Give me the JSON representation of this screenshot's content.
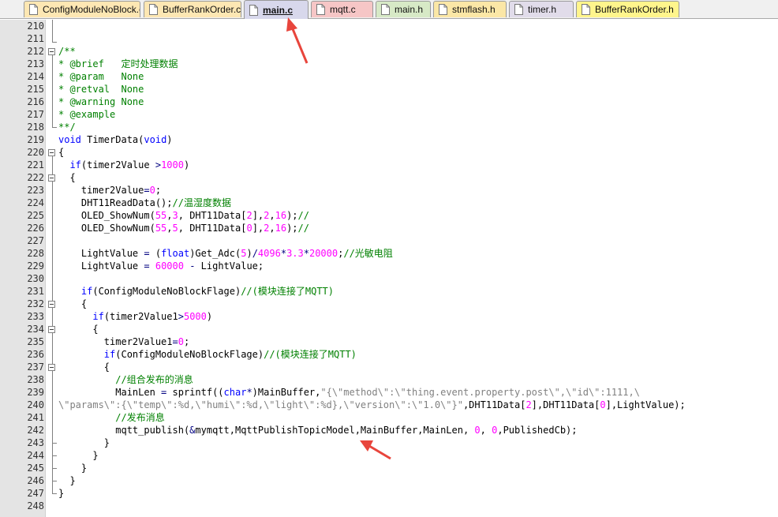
{
  "tabs": [
    {
      "label": "ConfigModuleNoBlock.c",
      "color": "#fde7b3",
      "active": false
    },
    {
      "label": "BufferRankOrder.c",
      "color": "#fde7b3",
      "active": false
    },
    {
      "label": "main.c",
      "color": "#d8d8ec",
      "active": true
    },
    {
      "label": "mqtt.c",
      "color": "#f6c6c6",
      "active": false
    },
    {
      "label": "main.h",
      "color": "#d7e9c6",
      "active": false
    },
    {
      "label": "stmflash.h",
      "color": "#fbe7a6",
      "active": false
    },
    {
      "label": "timer.h",
      "color": "#e1dcea",
      "active": false
    },
    {
      "label": "BufferRankOrder.h",
      "color": "#fff58c",
      "active": false
    }
  ],
  "editor": {
    "lines": [
      {
        "num": "210",
        "tokens": []
      },
      {
        "num": "211",
        "tokens": []
      },
      {
        "num": "212",
        "tokens": [
          [
            "c",
            "/**"
          ]
        ]
      },
      {
        "num": "213",
        "tokens": [
          [
            "c",
            "* @brief   定时处理数据"
          ]
        ]
      },
      {
        "num": "214",
        "tokens": [
          [
            "c",
            "* @param   None"
          ]
        ]
      },
      {
        "num": "215",
        "tokens": [
          [
            "c",
            "* @retval  None"
          ]
        ]
      },
      {
        "num": "216",
        "tokens": [
          [
            "c",
            "* @warning None"
          ]
        ]
      },
      {
        "num": "217",
        "tokens": [
          [
            "c",
            "* @example"
          ]
        ]
      },
      {
        "num": "218",
        "tokens": [
          [
            "c",
            "**/"
          ]
        ]
      },
      {
        "num": "219",
        "tokens": [
          [
            "k",
            "void"
          ],
          [
            "p",
            " TimerData("
          ],
          [
            "k",
            "void"
          ],
          [
            "p",
            ")"
          ]
        ]
      },
      {
        "num": "220",
        "tokens": [
          [
            "p",
            "{"
          ]
        ]
      },
      {
        "num": "221",
        "tokens": [
          [
            "p",
            "  "
          ],
          [
            "k",
            "if"
          ],
          [
            "p",
            "(timer2Value "
          ],
          [
            "o",
            ">"
          ],
          [
            "n",
            "1000"
          ],
          [
            "p",
            ")"
          ]
        ]
      },
      {
        "num": "222",
        "tokens": [
          [
            "p",
            "  {"
          ]
        ]
      },
      {
        "num": "223",
        "tokens": [
          [
            "p",
            "    timer2Value"
          ],
          [
            "o",
            "="
          ],
          [
            "n",
            "0"
          ],
          [
            "p",
            ";"
          ]
        ]
      },
      {
        "num": "224",
        "tokens": [
          [
            "p",
            "    DHT11ReadData();"
          ],
          [
            "c",
            "//温湿度数据"
          ]
        ]
      },
      {
        "num": "225",
        "tokens": [
          [
            "p",
            "    OLED_ShowNum("
          ],
          [
            "n",
            "55"
          ],
          [
            "p",
            ","
          ],
          [
            "n",
            "3"
          ],
          [
            "p",
            ", DHT11Data["
          ],
          [
            "n",
            "2"
          ],
          [
            "p",
            "],"
          ],
          [
            "n",
            "2"
          ],
          [
            "p",
            ","
          ],
          [
            "n",
            "16"
          ],
          [
            "p",
            ");"
          ],
          [
            "c",
            "//"
          ]
        ]
      },
      {
        "num": "226",
        "tokens": [
          [
            "p",
            "    OLED_ShowNum("
          ],
          [
            "n",
            "55"
          ],
          [
            "p",
            ","
          ],
          [
            "n",
            "5"
          ],
          [
            "p",
            ", DHT11Data["
          ],
          [
            "n",
            "0"
          ],
          [
            "p",
            "],"
          ],
          [
            "n",
            "2"
          ],
          [
            "p",
            ","
          ],
          [
            "n",
            "16"
          ],
          [
            "p",
            ");"
          ],
          [
            "c",
            "//"
          ]
        ]
      },
      {
        "num": "227",
        "tokens": []
      },
      {
        "num": "228",
        "tokens": [
          [
            "p",
            "    LightValue "
          ],
          [
            "o",
            "="
          ],
          [
            "p",
            " ("
          ],
          [
            "k",
            "float"
          ],
          [
            "p",
            ")Get_Adc("
          ],
          [
            "n",
            "5"
          ],
          [
            "p",
            ")"
          ],
          [
            "o",
            "/"
          ],
          [
            "n",
            "4096"
          ],
          [
            "o",
            "*"
          ],
          [
            "n",
            "3.3"
          ],
          [
            "o",
            "*"
          ],
          [
            "n",
            "20000"
          ],
          [
            "p",
            ";"
          ],
          [
            "c",
            "//光敏电阻"
          ]
        ]
      },
      {
        "num": "229",
        "tokens": [
          [
            "p",
            "    LightValue "
          ],
          [
            "o",
            "="
          ],
          [
            "p",
            " "
          ],
          [
            "n",
            "60000"
          ],
          [
            "p",
            " "
          ],
          [
            "o",
            "-"
          ],
          [
            "p",
            " LightValue;"
          ]
        ]
      },
      {
        "num": "230",
        "tokens": []
      },
      {
        "num": "231",
        "tokens": [
          [
            "p",
            "    "
          ],
          [
            "k",
            "if"
          ],
          [
            "p",
            "(ConfigModuleNoBlockFlage)"
          ],
          [
            "c",
            "//(模块连接了MQTT)"
          ]
        ]
      },
      {
        "num": "232",
        "tokens": [
          [
            "p",
            "    {"
          ]
        ]
      },
      {
        "num": "233",
        "tokens": [
          [
            "p",
            "      "
          ],
          [
            "k",
            "if"
          ],
          [
            "p",
            "(timer2Value1"
          ],
          [
            "o",
            ">"
          ],
          [
            "n",
            "5000"
          ],
          [
            "p",
            ")"
          ]
        ]
      },
      {
        "num": "234",
        "tokens": [
          [
            "p",
            "      {"
          ]
        ]
      },
      {
        "num": "235",
        "tokens": [
          [
            "p",
            "        timer2Value1"
          ],
          [
            "o",
            "="
          ],
          [
            "n",
            "0"
          ],
          [
            "p",
            ";"
          ]
        ]
      },
      {
        "num": "236",
        "tokens": [
          [
            "p",
            "        "
          ],
          [
            "k",
            "if"
          ],
          [
            "p",
            "(ConfigModuleNoBlockFlage)"
          ],
          [
            "c",
            "//(模块连接了MQTT)"
          ]
        ]
      },
      {
        "num": "237",
        "tokens": [
          [
            "p",
            "        {"
          ]
        ]
      },
      {
        "num": "238",
        "tokens": [
          [
            "p",
            "          "
          ],
          [
            "c",
            "//组合发布的消息"
          ]
        ]
      },
      {
        "num": "239",
        "tokens": [
          [
            "p",
            "          MainLen "
          ],
          [
            "o",
            "="
          ],
          [
            "p",
            " sprintf(("
          ],
          [
            "k",
            "char"
          ],
          [
            "o",
            "*"
          ],
          [
            "p",
            ")MainBuffer,"
          ],
          [
            "s",
            "\"{\\\"method\\\":\\\"thing.event.property.post\\\",\\\"id\\\":1111,\\"
          ]
        ]
      },
      {
        "num": "240",
        "tokens": [
          [
            "s",
            "\\\"params\\\":{\\\"temp\\\":%d,\\\"humi\\\":%d,\\\"light\\\":%d},\\\"version\\\":\\\"1.0\\\"}\""
          ],
          [
            "p",
            ",DHT11Data["
          ],
          [
            "n",
            "2"
          ],
          [
            "p",
            "],DHT11Data["
          ],
          [
            "n",
            "0"
          ],
          [
            "p",
            "],LightValue);"
          ]
        ]
      },
      {
        "num": "241",
        "tokens": [
          [
            "p",
            "          "
          ],
          [
            "c",
            "//发布消息"
          ]
        ]
      },
      {
        "num": "242",
        "tokens": [
          [
            "p",
            "          mqtt_publish("
          ],
          [
            "o",
            "&"
          ],
          [
            "p",
            "mymqtt,MqttPublishTopicModel,MainBuffer,MainLen, "
          ],
          [
            "n",
            "0"
          ],
          [
            "p",
            ", "
          ],
          [
            "n",
            "0"
          ],
          [
            "p",
            ",PublishedCb);"
          ]
        ]
      },
      {
        "num": "243",
        "tokens": [
          [
            "p",
            "        }"
          ]
        ]
      },
      {
        "num": "244",
        "tokens": [
          [
            "p",
            "      }"
          ]
        ]
      },
      {
        "num": "245",
        "tokens": [
          [
            "p",
            "    }"
          ]
        ]
      },
      {
        "num": "246",
        "tokens": [
          [
            "p",
            "  }"
          ]
        ]
      },
      {
        "num": "247",
        "tokens": [
          [
            "p",
            "}"
          ]
        ]
      },
      {
        "num": "248",
        "tokens": []
      }
    ]
  },
  "colors": {
    "keyword": "#0000ff",
    "comment": "#008000",
    "number": "#ff00ff",
    "string": "#808080",
    "annotation_arrow": "#e8453c"
  },
  "icons": [
    "file-icon",
    "fold-minus-icon",
    "annotation-arrow"
  ]
}
